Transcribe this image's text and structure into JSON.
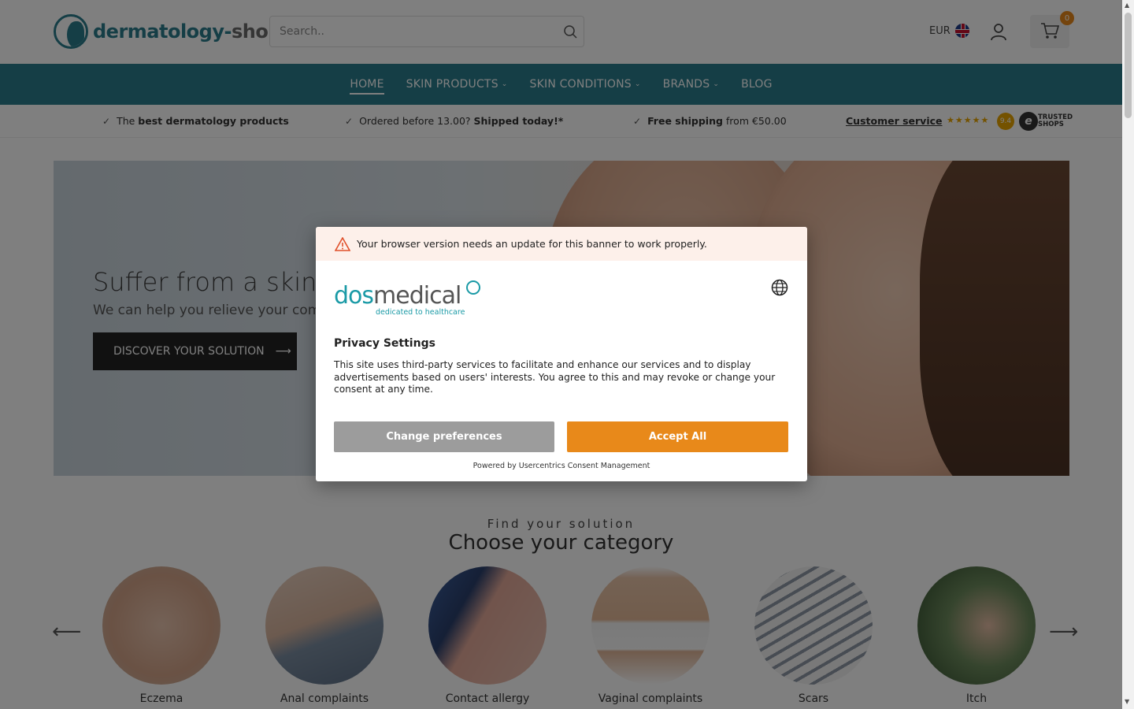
{
  "header": {
    "logo_part1": "dermatology-",
    "logo_part2": "shop",
    "search_placeholder": "Search..",
    "currency": "EUR",
    "cart_count": "0"
  },
  "nav": {
    "items": [
      {
        "label": "HOME",
        "active": true
      },
      {
        "label": "SKIN PRODUCTS",
        "has_dropdown": true
      },
      {
        "label": "SKIN CONDITIONS",
        "has_dropdown": true
      },
      {
        "label": "BRANDS",
        "has_dropdown": true
      },
      {
        "label": "BLOG"
      }
    ]
  },
  "usp": {
    "item1_pre": "The ",
    "item1_bold": "best dermatology products",
    "item2_pre": "Ordered before 13.00? ",
    "item2_bold": "Shipped today!*",
    "item3_bold": "Free shipping",
    "item3_post": " from €50.00",
    "customer_service": "Customer service",
    "rating": "9.4",
    "trusted_shops": "TRUSTED SHOPS"
  },
  "hero": {
    "title": "Suffer from a skin c",
    "subtitle": "We can help you relieve your comp",
    "button_label": "DISCOVER YOUR SOLUTION"
  },
  "categories": {
    "kicker": "Find your solution",
    "title": "Choose your category",
    "items": [
      {
        "label": "Eczema"
      },
      {
        "label": "Anal complaints"
      },
      {
        "label": "Contact allergy"
      },
      {
        "label": "Vaginal complaints"
      },
      {
        "label": "Scars"
      },
      {
        "label": "Itch"
      }
    ]
  },
  "consent": {
    "warning": "Your browser version needs an update for this banner to work properly.",
    "brand_dos": "dos",
    "brand_medical": "medical",
    "brand_tagline": "dedicated to healthcare",
    "title": "Privacy Settings",
    "body": "This site uses third-party services to facilitate and enhance our services and to display advertisements based on users' interests. You agree to this and may revoke or change your consent at any time.",
    "change_label": "Change preferences",
    "accept_label": "Accept All",
    "powered_by": "Powered by Usercentrics Consent Management"
  },
  "colors": {
    "brand_teal": "#2a7d8c",
    "accept_orange": "#e8891a",
    "change_gray": "#9c9c9c",
    "dosmedical_teal": "#1a9aa6"
  }
}
